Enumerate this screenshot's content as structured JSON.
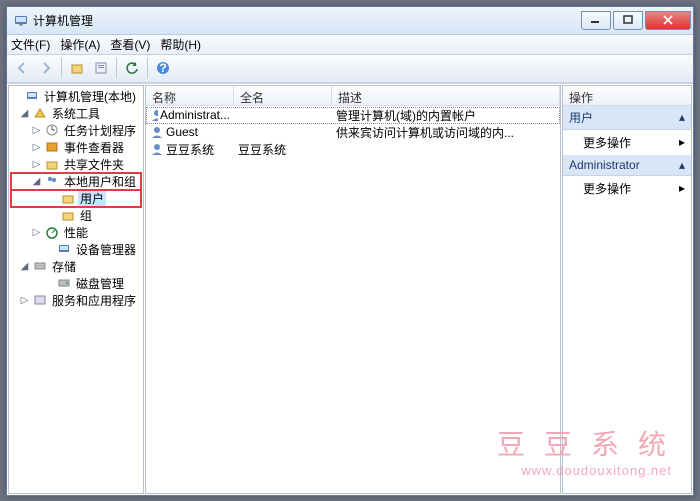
{
  "title": "计算机管理",
  "menu": {
    "file": "文件(F)",
    "action": "操作(A)",
    "view": "查看(V)",
    "help": "帮助(H)"
  },
  "tree": {
    "root": "计算机管理(本地)",
    "system_tools": "系统工具",
    "task_scheduler": "任务计划程序",
    "event_viewer": "事件查看器",
    "shared_folders": "共享文件夹",
    "local_users_groups": "本地用户和组",
    "users": "用户",
    "groups": "组",
    "performance": "性能",
    "device_manager": "设备管理器",
    "storage": "存储",
    "disk_management": "磁盘管理",
    "services_apps": "服务和应用程序"
  },
  "columns": {
    "name": "名称",
    "fullname": "全名",
    "desc": "描述"
  },
  "users": [
    {
      "name": "Administrat...",
      "fullname": "",
      "desc": "管理计算机(域)的内置帐户"
    },
    {
      "name": "Guest",
      "fullname": "",
      "desc": "供来宾访问计算机或访问域的内..."
    },
    {
      "name": "豆豆系统",
      "fullname": "豆豆系统",
      "desc": ""
    }
  ],
  "actions": {
    "header": "操作",
    "group1_title": "用户",
    "more1": "更多操作",
    "group2_title": "Administrator",
    "more2": "更多操作"
  },
  "watermark": {
    "line1": "豆 豆 系 统",
    "line2": "www.doudouxitong.net"
  }
}
